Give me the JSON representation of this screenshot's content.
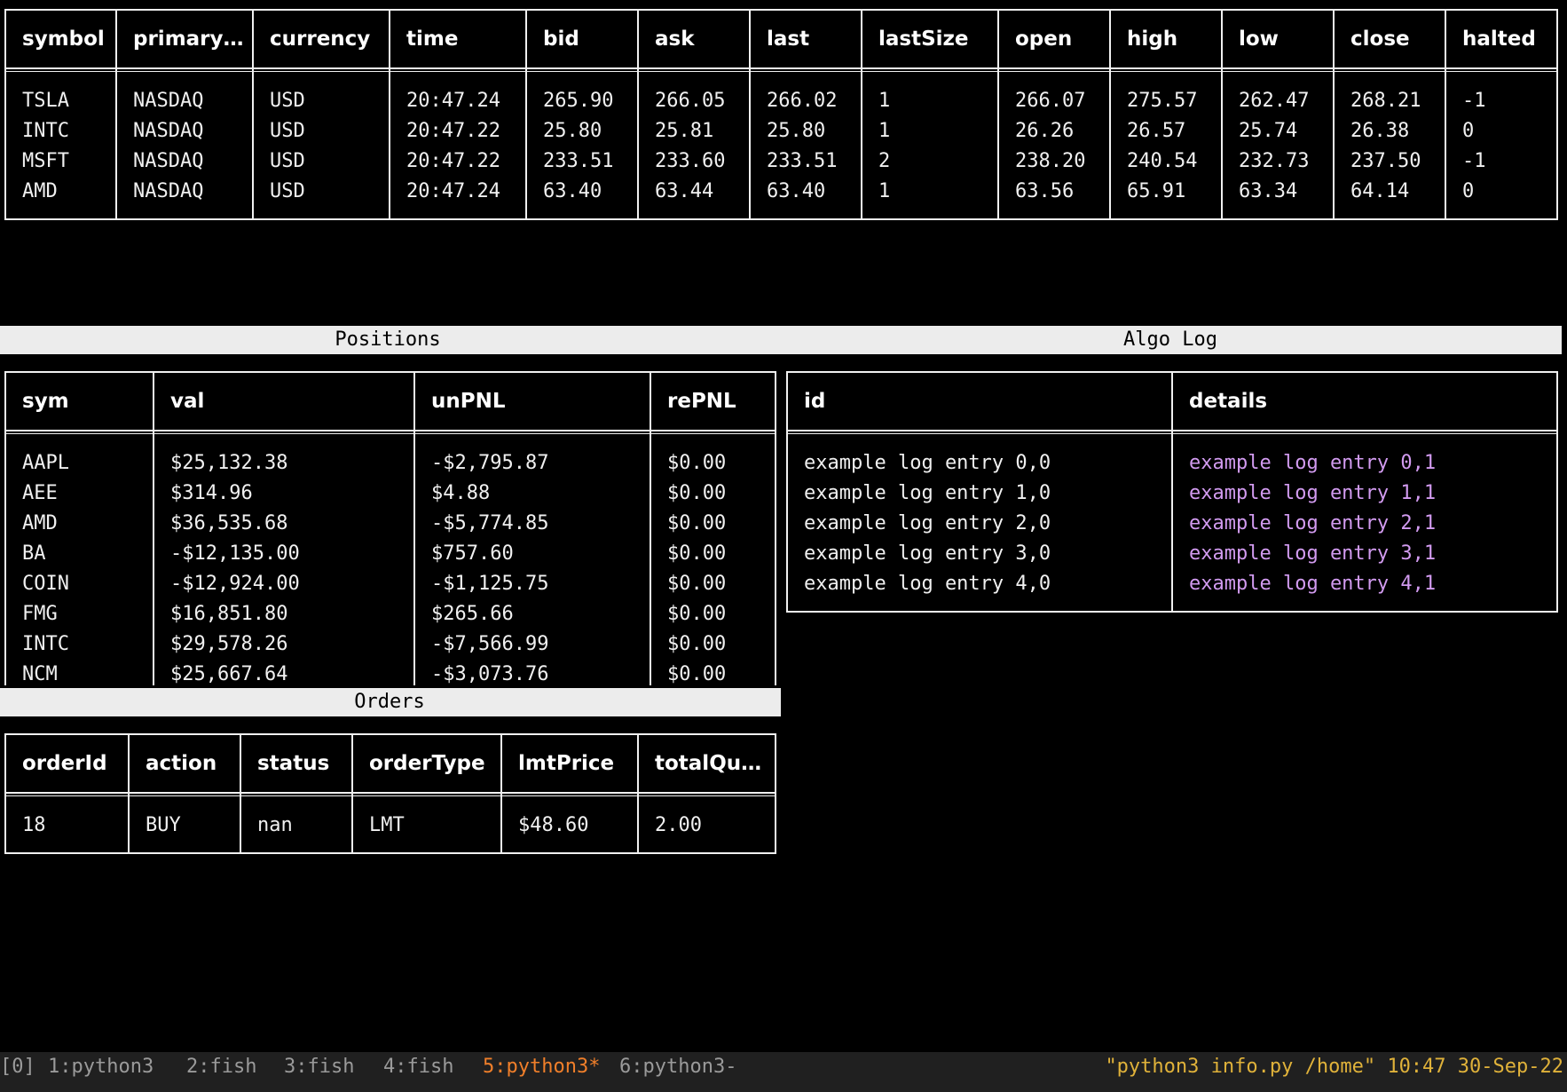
{
  "quotes": {
    "columns": [
      "symbol",
      "primary…",
      "currency",
      "time",
      "bid",
      "ask",
      "last",
      "lastSize",
      "open",
      "high",
      "low",
      "close",
      "halted"
    ],
    "rows": [
      [
        "TSLA",
        "NASDAQ",
        "USD",
        "20:47.24",
        "265.90",
        "266.05",
        "266.02",
        "1",
        "266.07",
        "275.57",
        "262.47",
        "268.21",
        "-1"
      ],
      [
        "INTC",
        "NASDAQ",
        "USD",
        "20:47.22",
        "25.80",
        "25.81",
        "25.80",
        "1",
        "26.26",
        "26.57",
        "25.74",
        "26.38",
        "0"
      ],
      [
        "MSFT",
        "NASDAQ",
        "USD",
        "20:47.22",
        "233.51",
        "233.60",
        "233.51",
        "2",
        "238.20",
        "240.54",
        "232.73",
        "237.50",
        "-1"
      ],
      [
        "AMD",
        "NASDAQ",
        "USD",
        "20:47.24",
        "63.40",
        "63.44",
        "63.40",
        "1",
        "63.56",
        "65.91",
        "63.34",
        "64.14",
        "0"
      ]
    ]
  },
  "positions": {
    "title": "Positions",
    "columns": [
      "sym",
      "val",
      "unPNL",
      "rePNL"
    ],
    "rows": [
      [
        "AAPL",
        "$25,132.38",
        "-$2,795.87",
        "$0.00"
      ],
      [
        "AEE",
        "$314.96",
        "$4.88",
        "$0.00"
      ],
      [
        "AMD",
        "$36,535.68",
        "-$5,774.85",
        "$0.00"
      ],
      [
        "BA",
        "-$12,135.00",
        "$757.60",
        "$0.00"
      ],
      [
        "COIN",
        "-$12,924.00",
        "-$1,125.75",
        "$0.00"
      ],
      [
        "FMG",
        "$16,851.80",
        "$265.66",
        "$0.00"
      ],
      [
        "INTC",
        "$29,578.26",
        "-$7,566.99",
        "$0.00"
      ],
      [
        "NCM",
        "$25,667.64",
        "-$3,073.76",
        "$0.00"
      ]
    ]
  },
  "algo_log": {
    "title": "Algo Log",
    "columns": [
      "id",
      "details"
    ],
    "rows": [
      [
        "example log entry 0,0",
        "example log entry 0,1"
      ],
      [
        "example log entry 1,0",
        "example log entry 1,1"
      ],
      [
        "example log entry 2,0",
        "example log entry 2,1"
      ],
      [
        "example log entry 3,0",
        "example log entry 3,1"
      ],
      [
        "example log entry 4,0",
        "example log entry 4,1"
      ]
    ]
  },
  "orders": {
    "title": "Orders",
    "columns": [
      "orderId",
      "action",
      "status",
      "orderType",
      "lmtPrice",
      "totalQu…"
    ],
    "rows": [
      [
        "18",
        "BUY",
        "nan",
        "LMT",
        "$48.60",
        "2.00"
      ]
    ]
  },
  "statusbar": {
    "session": "[0]",
    "windows": [
      {
        "label": "1:python3",
        "active": false
      },
      {
        "label": "2:fish",
        "active": false
      },
      {
        "label": "3:fish",
        "active": false
      },
      {
        "label": "4:fish",
        "active": false
      },
      {
        "label": "5:python3*",
        "active": true
      },
      {
        "label": "6:python3-",
        "active": false
      }
    ],
    "right": "\"python3 info.py /home\" 10:47 30-Sep-22"
  },
  "colors": {
    "background": "#000000",
    "text": "#f0f0f0",
    "log_details": "#d29bf0",
    "active_window": "#f07f2a",
    "status_right": "#e0b23a",
    "title_bar": "#ececec"
  }
}
